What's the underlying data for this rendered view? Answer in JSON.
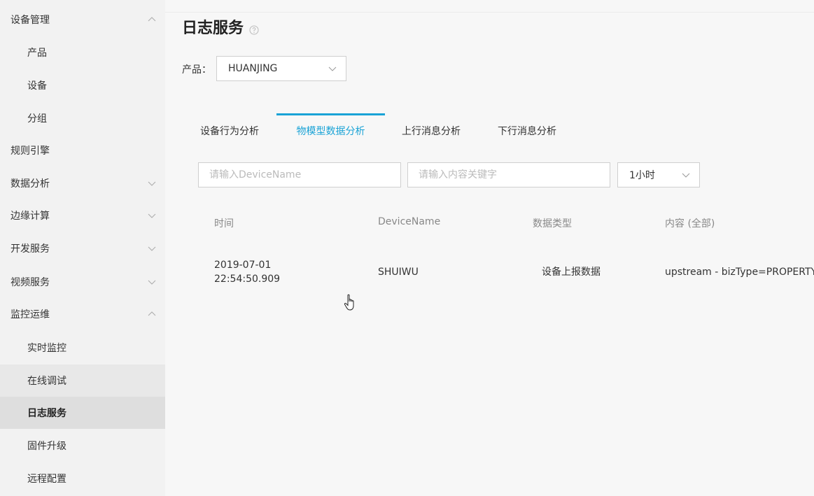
{
  "sidebar": {
    "items": [
      {
        "label": "设备管理",
        "chevron": "up"
      },
      {
        "label": "产品"
      },
      {
        "label": "设备"
      },
      {
        "label": "分组"
      },
      {
        "label": "规则引擎"
      },
      {
        "label": "数据分析",
        "chevron": "down"
      },
      {
        "label": "边缘计算",
        "chevron": "down"
      },
      {
        "label": "开发服务",
        "chevron": "down"
      },
      {
        "label": "视频服务",
        "chevron": "down"
      },
      {
        "label": "监控运维",
        "chevron": "up"
      },
      {
        "label": "实时监控"
      },
      {
        "label": "在线调试"
      },
      {
        "label": "日志服务",
        "active": true
      },
      {
        "label": "固件升级"
      },
      {
        "label": "远程配置"
      }
    ]
  },
  "page": {
    "title": "日志服务",
    "product_label": "产品：",
    "product_value": "HUANJING"
  },
  "tabs": [
    {
      "label": "设备行为分析"
    },
    {
      "label": "物模型数据分析",
      "active": true
    },
    {
      "label": "上行消息分析"
    },
    {
      "label": "下行消息分析"
    }
  ],
  "filters": {
    "device_name_placeholder": "请输入DeviceName",
    "keyword_placeholder": "请输入内容关键字",
    "time_range": "1小时"
  },
  "table": {
    "headers": [
      "时间",
      "DeviceName",
      "数据类型",
      "内容 (全部)"
    ],
    "rows": [
      {
        "time_date": "2019-07-01",
        "time_clock": "22:54:50.909",
        "device_name": "SHUIWU",
        "data_type": "设备上报数据",
        "content": "upstream - bizType=PROPERTY"
      }
    ]
  },
  "colors": {
    "accent": "#1aa3d6",
    "sidebar_bg": "#f2f2f2",
    "active_item_bg": "#dedede"
  },
  "icons": {
    "help": "question-circle-icon",
    "expand": "chevron-down-icon",
    "collapse": "chevron-up-icon",
    "cursor": "hand-pointer-icon"
  }
}
